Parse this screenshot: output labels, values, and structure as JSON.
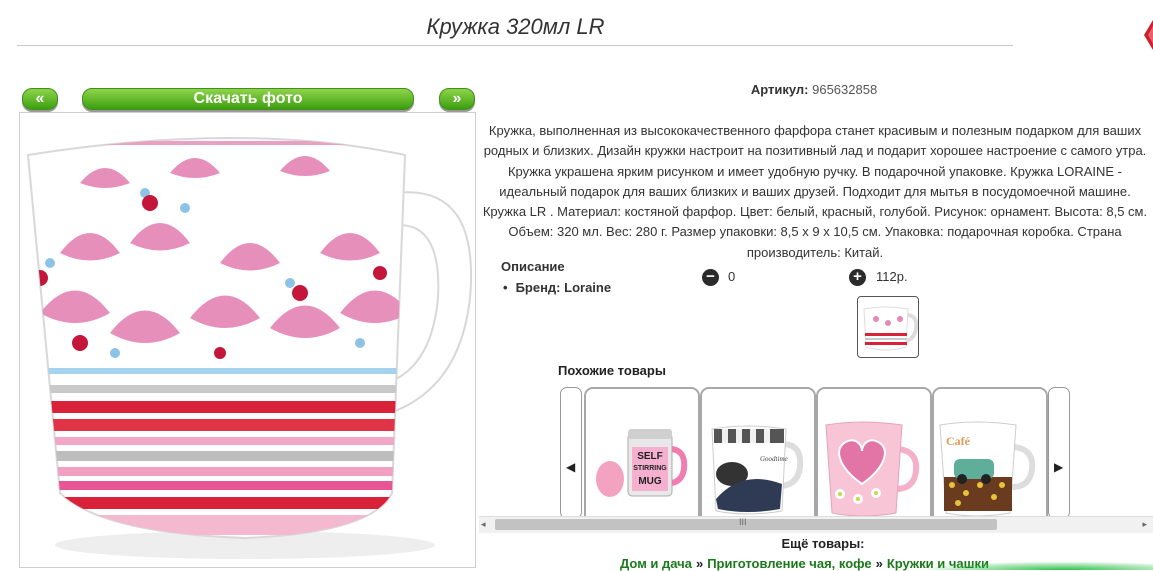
{
  "product": {
    "title": "Кружка 320мл LR",
    "article_label": "Артикул:",
    "article_value": "965632858",
    "description": "Кружка, выполненная из высококачественного фарфора станет красивым и полезным подарком для ваших родных и близких. Дизайн кружки настроит на позитивный лад и подарит хорошее настроение с самого утра. Кружка украшена ярким рисунком и имеет удобную ручку. В подарочной упаковке. Кружка LORAINE - идеальный подарок для ваших близких и ваших друзей. Подходит для мытья в посудомоечной машине. Кружка LR . Материал: костяной фарфор. Цвет: белый, красный, голубой. Рисунок: орнамент. Высота: 8,5 см. Объем: 320 мл. Вес: 280 г. Размер упаковки: 8,5 х 9 х 10,5 см. Упаковка: подарочная коробка. Страна производитель: Китай.",
    "specs_heading": "Описание",
    "brand_spec": "Бренд: Loraine",
    "quantity": "0",
    "price": "112р."
  },
  "gallery": {
    "prev_label": "«",
    "download_label": "Скачать фото",
    "next_label": "»"
  },
  "controls": {
    "minus_icon": "minus-circle-icon",
    "minus_glyph": "−",
    "plus_icon": "plus-circle-icon",
    "plus_glyph": "+"
  },
  "similar": {
    "heading": "Похожие товары",
    "left_arrow": "◀",
    "right_arrow": "▶",
    "items": [
      {
        "image_text": [
          "SELF",
          "STIRRING",
          "MUG"
        ]
      },
      {
        "image_text": [
          "Goodtime"
        ]
      },
      {
        "image_text": []
      },
      {
        "image_text": [
          "Café"
        ]
      }
    ]
  },
  "scrollbar": {
    "left_arrow": "◂",
    "grip": "III",
    "right_arrow": "▸"
  },
  "more": {
    "heading": "Ещё товары:",
    "breadcrumbs": [
      "Дом и дача",
      "Приготовление чая, кофе",
      "Кружки и чашки"
    ],
    "separator": "»"
  },
  "colors": {
    "accent_green": "#3b9f0f",
    "link_green": "#1a7a1a",
    "mug_red": "#d9223a",
    "mug_pink": "#e58ab8",
    "mug_blue": "#8cc3e6"
  }
}
